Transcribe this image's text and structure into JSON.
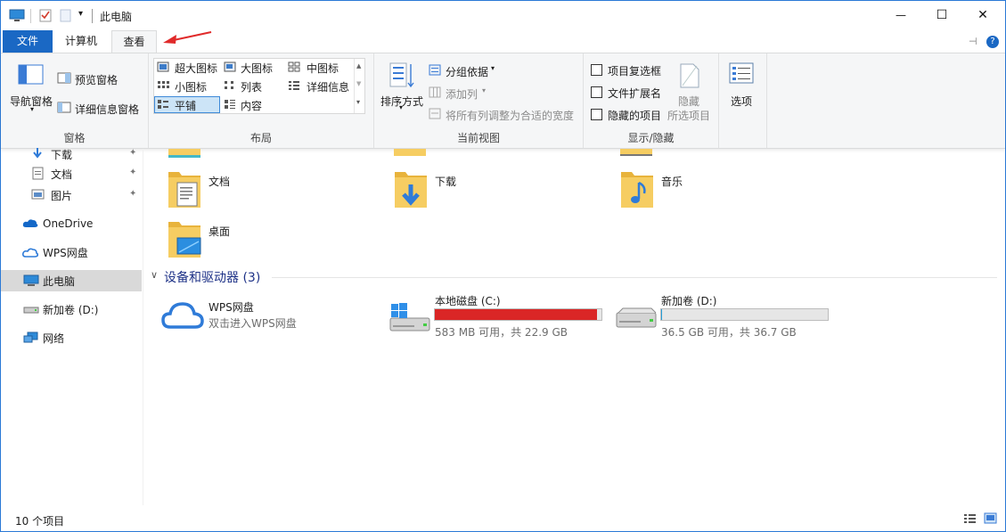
{
  "window": {
    "title": "此电脑",
    "controls": {
      "minimize": "—",
      "maximize": "☐",
      "close": "✕"
    }
  },
  "tabs": {
    "file": "文件",
    "computer": "计算机",
    "view": "查看"
  },
  "ribbon": {
    "pane_group": {
      "nav_pane": "导航窗格",
      "preview_pane": "预览窗格",
      "details_pane": "详细信息窗格",
      "label": "窗格"
    },
    "layout_group": {
      "items": [
        "超大图标",
        "大图标",
        "中图标",
        "小图标",
        "列表",
        "详细信息",
        "平铺",
        "内容"
      ],
      "selected": "平铺",
      "label": "布局"
    },
    "current_view_group": {
      "sort_by": "排序方式",
      "group_by": "分组依据",
      "add_column": "添加列",
      "fit_columns": "将所有列调整为合适的宽度",
      "label": "当前视图"
    },
    "show_hide_group": {
      "item_checkboxes": "项目复选框",
      "file_extensions": "文件扩展名",
      "hidden_items": "隐藏的项目",
      "hide": "隐藏",
      "selected_items": "所选项目",
      "label": "显示/隐藏"
    },
    "options": "选项"
  },
  "sidebar": {
    "items": [
      {
        "label": "下载",
        "icon": "download-icon",
        "pinned": true
      },
      {
        "label": "文档",
        "icon": "document-icon",
        "pinned": true
      },
      {
        "label": "图片",
        "icon": "picture-icon",
        "pinned": true
      },
      {
        "label": "OneDrive",
        "icon": "cloud-icon",
        "pinned": false
      },
      {
        "label": "WPS网盘",
        "icon": "wps-cloud-icon",
        "pinned": false
      },
      {
        "label": "此电脑",
        "icon": "computer-icon",
        "pinned": false,
        "selected": true
      },
      {
        "label": "新加卷 (D:)",
        "icon": "drive-icon",
        "pinned": false
      },
      {
        "label": "网络",
        "icon": "network-icon",
        "pinned": false
      }
    ]
  },
  "folders": [
    {
      "label": "文档",
      "icon": "documents-folder-icon"
    },
    {
      "label": "下载",
      "icon": "downloads-folder-icon"
    },
    {
      "label": "音乐",
      "icon": "music-folder-icon"
    },
    {
      "label": "桌面",
      "icon": "desktop-folder-icon"
    }
  ],
  "devices_section": {
    "title": "设备和驱动器 (3)"
  },
  "devices": [
    {
      "name": "WPS网盘",
      "sub": "双击进入WPS网盘",
      "icon": "wps-cloud-icon"
    },
    {
      "name": "本地磁盘 (C:)",
      "sub": "583 MB 可用，共 22.9 GB",
      "icon": "windows-drive-icon",
      "used_fraction": 0.975,
      "bar_color": "#da2626"
    },
    {
      "name": "新加卷 (D:)",
      "sub": "36.5 GB 可用，共 36.7 GB",
      "icon": "drive-icon",
      "used_fraction": 0.006,
      "bar_color": "#26a0da"
    }
  ],
  "status": {
    "item_count": "10 个项目"
  },
  "colors": {
    "accent": "#1a68c4",
    "annotation_arrow": "#e02a2a"
  }
}
